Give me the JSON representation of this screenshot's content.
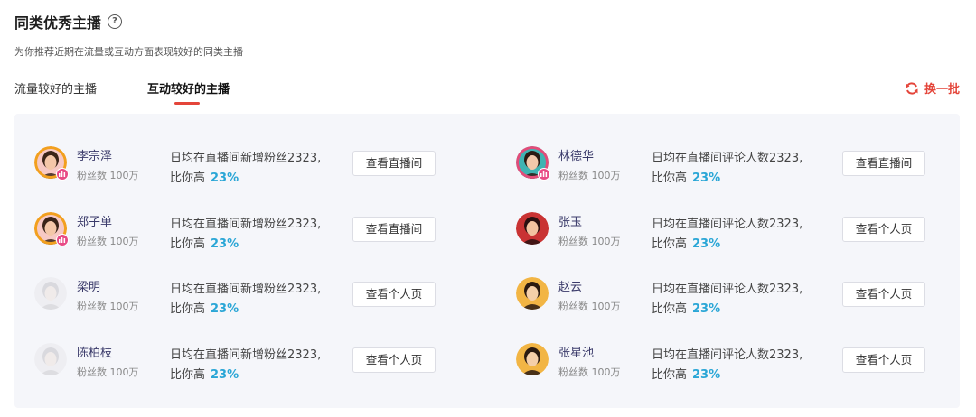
{
  "header": {
    "title": "同类优秀主播",
    "help_icon": "question-circle-icon",
    "subtitle": "为你推荐近期在流量或互动方面表现较好的同类主播"
  },
  "tabs": [
    {
      "label": "流量较好的主播",
      "active": false
    },
    {
      "label": "互动较好的主播",
      "active": true
    }
  ],
  "refresh": {
    "label": "换一批",
    "icon": "refresh-icon"
  },
  "accent_color": "#e4453a",
  "highlight_color": "#2aa6d6",
  "left_column": [
    {
      "name": "李宗泽",
      "fans": "粉丝数 100万",
      "line1": "日均在直播间新增粉丝2323,",
      "line2_prefix": "比你高",
      "percent": "23%",
      "button": "查看直播间",
      "live": true,
      "avatar_style": "pink"
    },
    {
      "name": "郑子单",
      "fans": "粉丝数 100万",
      "line1": "日均在直播间新增粉丝2323,",
      "line2_prefix": "比你高",
      "percent": "23%",
      "button": "查看直播间",
      "live": true,
      "avatar_style": "pink"
    },
    {
      "name": "梁明",
      "fans": "粉丝数 100万",
      "line1": "日均在直播间新增粉丝2323,",
      "line2_prefix": "比你高",
      "percent": "23%",
      "button": "查看个人页",
      "live": false,
      "avatar_style": "white"
    },
    {
      "name": "陈柏枝",
      "fans": "粉丝数 100万",
      "line1": "日均在直播间新增粉丝2323,",
      "line2_prefix": "比你高",
      "percent": "23%",
      "button": "查看个人页",
      "live": false,
      "avatar_style": "white"
    }
  ],
  "right_column": [
    {
      "name": "林德华",
      "fans": "粉丝数 100万",
      "line1": "日均在直播间评论人数2323,",
      "line2_prefix": "比你高",
      "percent": "23%",
      "button": "查看直播间",
      "live": true,
      "avatar_style": "teal"
    },
    {
      "name": "张玉",
      "fans": "粉丝数 100万",
      "line1": "日均在直播间评论人数2323,",
      "line2_prefix": "比你高",
      "percent": "23%",
      "button": "查看个人页",
      "live": false,
      "avatar_style": "red"
    },
    {
      "name": "赵云",
      "fans": "粉丝数 100万",
      "line1": "日均在直播间评论人数2323,",
      "line2_prefix": "比你高",
      "percent": "23%",
      "button": "查看个人页",
      "live": false,
      "avatar_style": "yellow"
    },
    {
      "name": "张星池",
      "fans": "粉丝数 100万",
      "line1": "日均在直播间评论人数2323,",
      "line2_prefix": "比你高",
      "percent": "23%",
      "button": "查看个人页",
      "live": false,
      "avatar_style": "yellow"
    }
  ]
}
